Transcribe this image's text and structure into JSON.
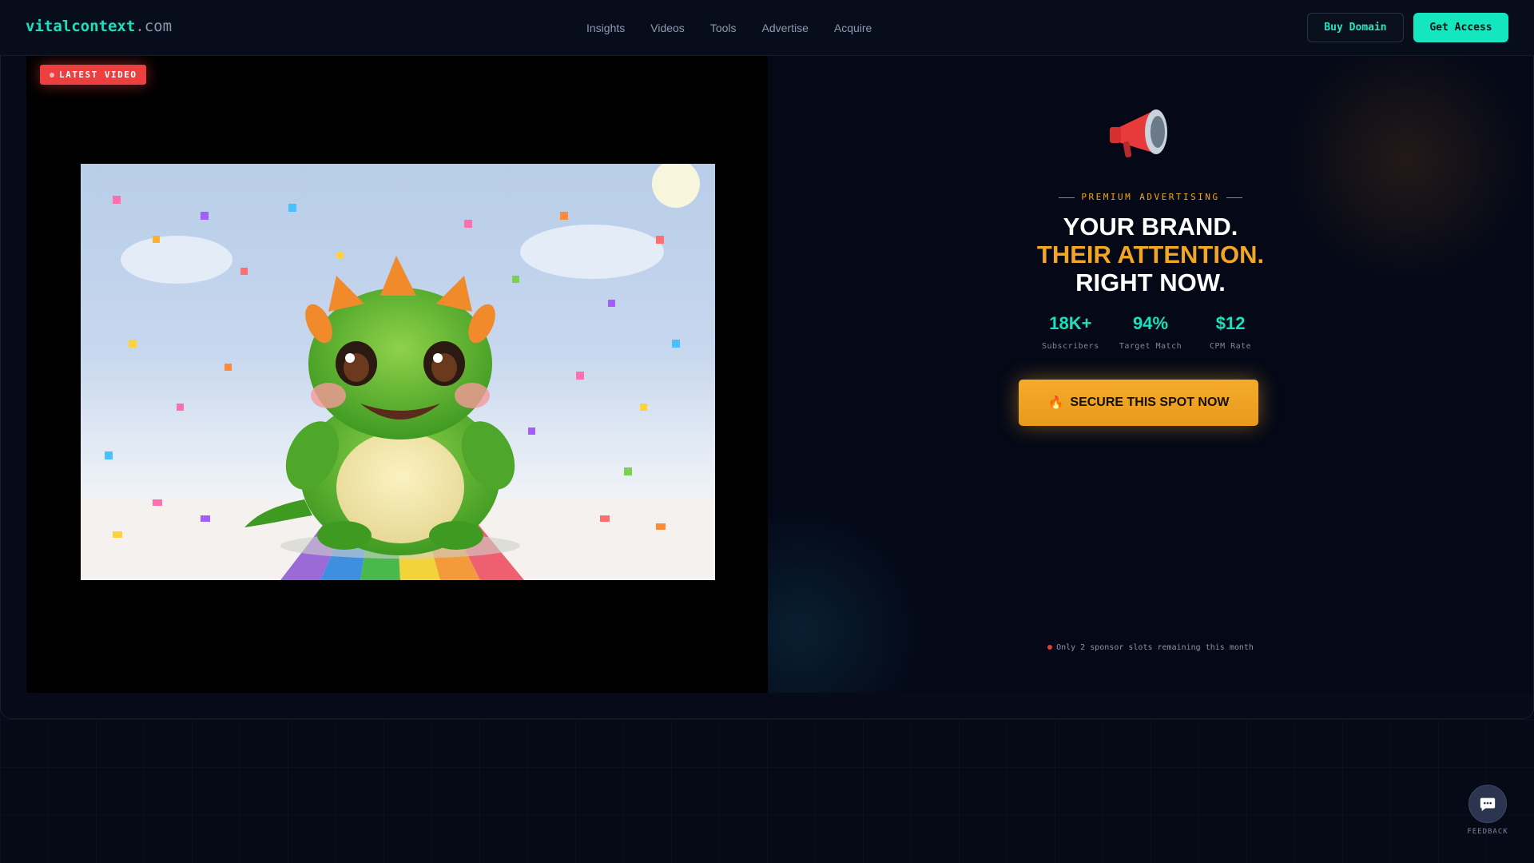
{
  "header": {
    "logo_main": "vitalcontext",
    "logo_tld": ".com",
    "nav": [
      "Insights",
      "Videos",
      "Tools",
      "Advertise",
      "Acquire"
    ],
    "buy_domain_label": "Buy Domain",
    "get_access_label": "Get Access"
  },
  "video": {
    "badge_label": "LATEST VIDEO"
  },
  "ad": {
    "eyebrow": "PREMIUM ADVERTISING",
    "headline": [
      "YOUR BRAND.",
      "THEIR ATTENTION.",
      "RIGHT NOW."
    ],
    "stats": [
      {
        "value": "18K+",
        "label": "Subscribers"
      },
      {
        "value": "94%",
        "label": "Target Match"
      },
      {
        "value": "$12",
        "label": "CPM Rate"
      }
    ],
    "cta_icon": "🔥",
    "cta_label": "SECURE THIS SPOT NOW",
    "scarcity": "Only 2 sponsor slots remaining this month"
  },
  "feedback": {
    "label": "FEEDBACK"
  },
  "colors": {
    "accent": "#14e6bf",
    "highlight": "#f3a623",
    "badge": "#ec3f3f"
  },
  "icons": {
    "ad": "megaphone-icon",
    "feedback": "chat-bubble-icon"
  }
}
